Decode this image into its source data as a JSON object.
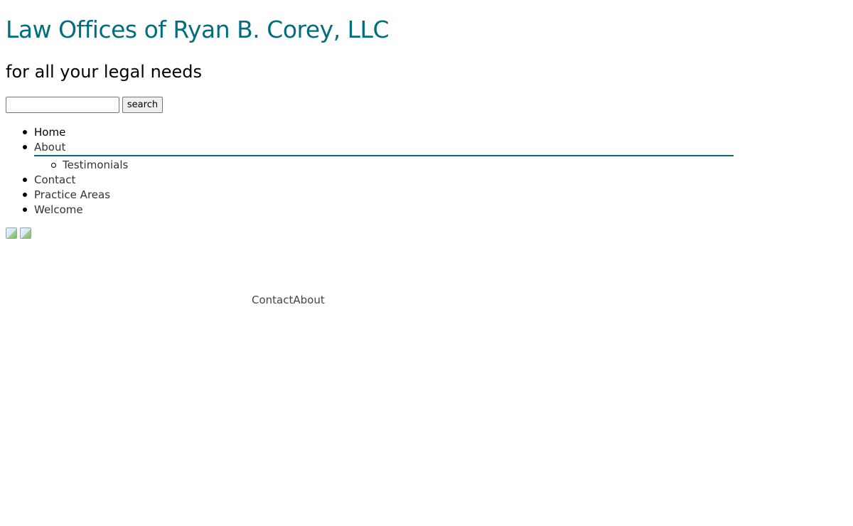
{
  "header": {
    "title": "Law Offices of Ryan B. Corey, LLC",
    "tagline": "for all your legal needs"
  },
  "search": {
    "value": "",
    "placeholder": "",
    "button_label": "search"
  },
  "nav": {
    "items": [
      {
        "label": "Home"
      },
      {
        "label": "About",
        "children": [
          {
            "label": "Testimonials"
          }
        ]
      },
      {
        "label": "Contact"
      },
      {
        "label": "Practice Areas"
      },
      {
        "label": "Welcome"
      }
    ]
  },
  "footer": {
    "links": [
      {
        "label": "Contact"
      },
      {
        "label": "About"
      }
    ]
  },
  "colors": {
    "brand": "#036d80",
    "text": "#333333",
    "background": "#ffffff"
  },
  "icons": [
    "broken-image-icon",
    "broken-image-icon"
  ]
}
